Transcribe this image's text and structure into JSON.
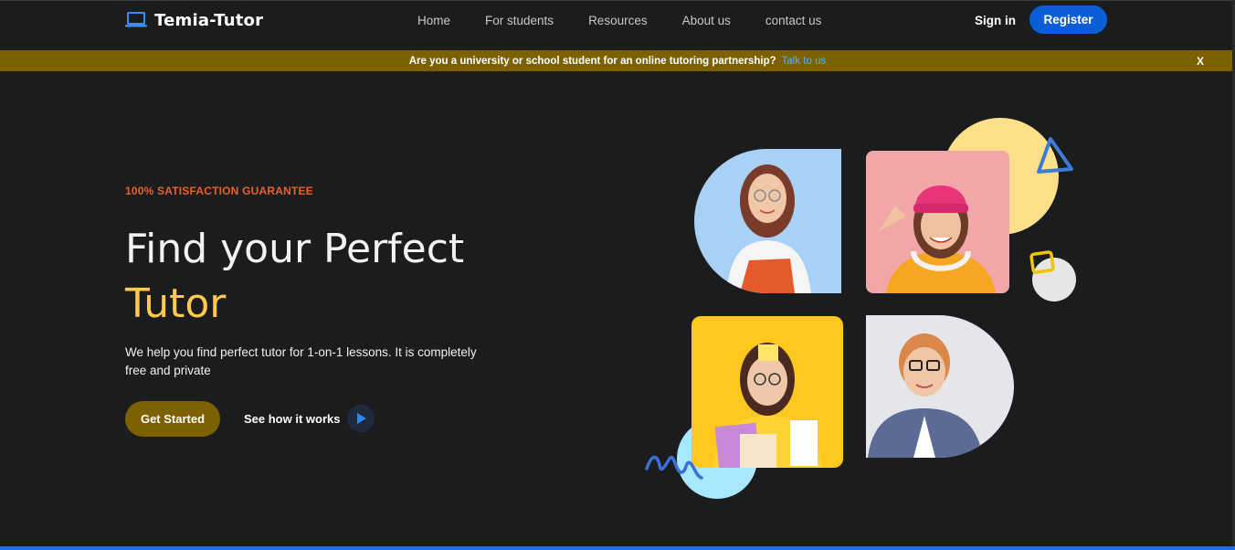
{
  "brand": {
    "name": "Temia-Tutor",
    "icon": "laptop-icon"
  },
  "nav": {
    "links": [
      "Home",
      "For students",
      "Resources",
      "About us",
      "contact us"
    ],
    "signin_label": "Sign in",
    "register_label": "Register"
  },
  "banner": {
    "text": "Are you a university or school student for an online tutoring partnership?",
    "link": "Talk to us",
    "close": "X"
  },
  "hero": {
    "tagline": "100% SATISFACTION GUARANTEE",
    "title_line1": "Find your Perfect",
    "title_line2": "Tutor",
    "description": "We help you find perfect tutor for 1-on-1 lessons. It is completely free and private",
    "cta_label": "Get Started",
    "secondary_label": "See how it works",
    "secondary_icon": "play-icon"
  },
  "colors": {
    "background": "#1b1c1e",
    "banner": "#7d6000",
    "accent_yellow": "#ffc94d",
    "accent_orange": "#e8612c",
    "primary_blue": "#0b5ed7",
    "link_blue": "#58b0ff"
  }
}
